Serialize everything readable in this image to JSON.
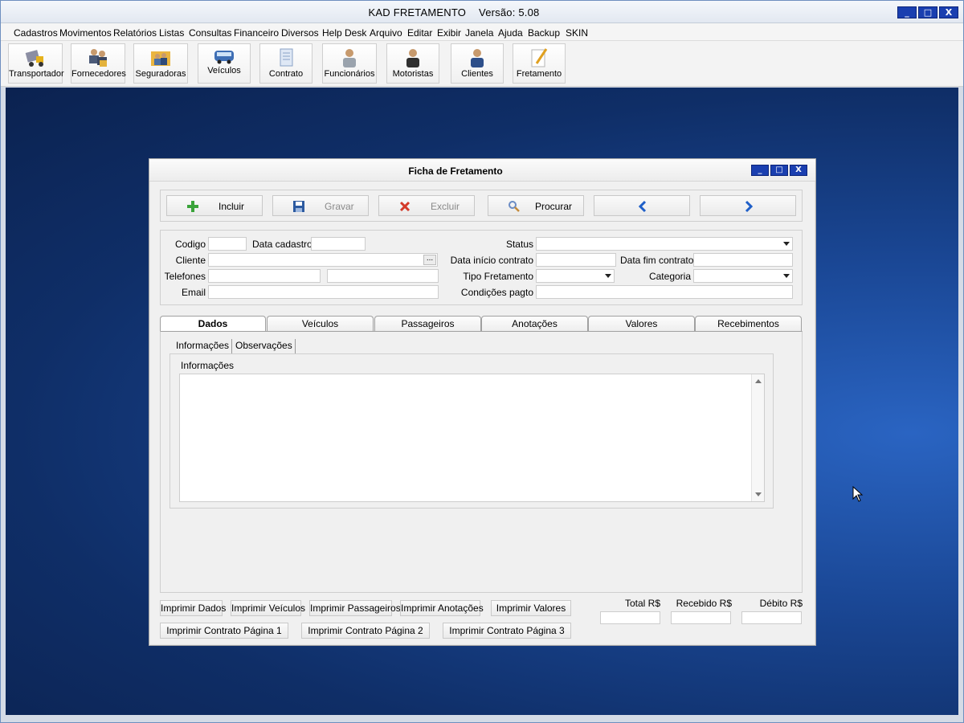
{
  "app": {
    "title": "KAD FRETAMENTO",
    "version": "Versão: 5.08",
    "window_buttons": [
      "_",
      "□",
      "X"
    ]
  },
  "menu": [
    "Cadastros",
    "Movimentos",
    "Relatórios",
    "Listas",
    "Consultas",
    "Financeiro",
    "Diversos",
    "Help Desk",
    "Arquivo",
    "Editar",
    "Exibir",
    "Janela",
    "Ajuda",
    "Backup",
    "SKIN"
  ],
  "toolbar": [
    {
      "label": "Transportador",
      "icon": "truck-icon"
    },
    {
      "label": "Fornecedores",
      "icon": "suppliers-icon"
    },
    {
      "label": "Seguradoras",
      "icon": "insurers-icon"
    },
    {
      "label": "Veículos",
      "icon": "bus-icon"
    },
    {
      "label": "Contrato",
      "icon": "contract-icon"
    },
    {
      "label": "Funcionários",
      "icon": "employee-icon"
    },
    {
      "label": "Motoristas",
      "icon": "driver-icon"
    },
    {
      "label": "Clientes",
      "icon": "client-icon"
    },
    {
      "label": "Fretamento",
      "icon": "pencil-note-icon"
    }
  ],
  "child": {
    "title": "Ficha de Fretamento",
    "actions": {
      "incluir": "Incluir",
      "gravar": "Gravar",
      "excluir": "Excluir",
      "procurar": "Procurar"
    },
    "form": {
      "codigo": "Codigo",
      "data_cadastro": "Data cadastro",
      "cliente": "Cliente",
      "telefones": "Telefones",
      "email": "Email",
      "status": "Status",
      "data_inicio": "Data início contrato",
      "data_fim": "Data fim contrato",
      "tipo_fretamento": "Tipo Fretamento",
      "categoria": "Categoria",
      "condicoes": "Condições pagto",
      "ellipsis": "..."
    },
    "tabs": [
      "Dados",
      "Veículos",
      "Passageiros",
      "Anotações",
      "Valores",
      "Recebimentos"
    ],
    "subtabs": [
      "Informações",
      "Observações"
    ],
    "info_label": "Informações",
    "print_buttons_row1": [
      "Imprimir Dados",
      "Imprimir Veículos",
      "Imprimir Passageiros",
      "Imprimir Anotações",
      "Imprimir Valores"
    ],
    "print_buttons_row2": [
      "Imprimir Contrato Página 1",
      "Imprimir Contrato Página 2",
      "Imprimir Contrato Página 3"
    ],
    "totals": {
      "total": "Total R$",
      "recebido": "Recebido R$",
      "debito": "Débito R$"
    }
  }
}
